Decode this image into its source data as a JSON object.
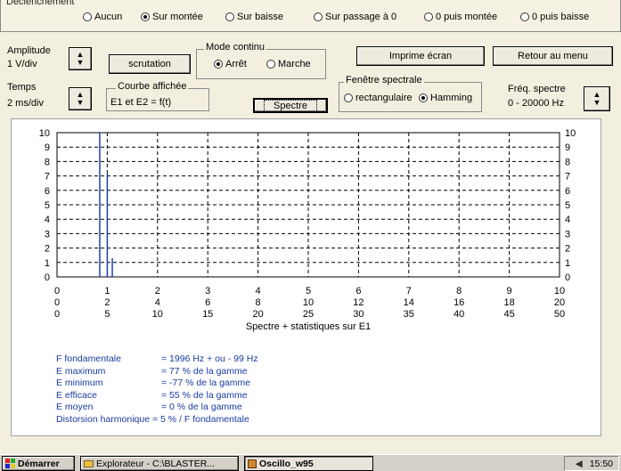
{
  "trigger": {
    "title": "Déclenchement",
    "options": [
      {
        "label": "Aucun",
        "selected": false
      },
      {
        "label": "Sur montée",
        "selected": true
      },
      {
        "label": "Sur baisse",
        "selected": false
      },
      {
        "label": "Sur passage à 0",
        "selected": false
      },
      {
        "label": "0 puis montée",
        "selected": false
      },
      {
        "label": "0 puis baisse",
        "selected": false
      }
    ]
  },
  "amplitude": {
    "label": "Amplitude",
    "value": "1 V/div"
  },
  "temps": {
    "label": "Temps",
    "value": "2 ms/div"
  },
  "scrutation_label": "scrutation",
  "mode": {
    "title": "Mode continu",
    "options": [
      {
        "label": "Arrêt",
        "selected": true
      },
      {
        "label": "Marche",
        "selected": false
      }
    ]
  },
  "courbe": {
    "title": "Courbe affichée",
    "value": "E1 et E2 = f(t)"
  },
  "spectre_label": "Spectre",
  "imprime_label": "Imprime écran",
  "retour_label": "Retour au menu",
  "fenetre": {
    "title": "Fenêtre spectrale",
    "options": [
      {
        "label": "rectangulaire",
        "selected": false
      },
      {
        "label": "Hamming",
        "selected": true
      }
    ]
  },
  "freq": {
    "label": "Fréq. spectre",
    "value": "0 - 20000 Hz"
  },
  "chart_data": {
    "type": "bar",
    "title": "Spectre + statistiques sur E1",
    "ylim": [
      0,
      10
    ],
    "y_ticks": [
      "0",
      "1",
      "2",
      "3",
      "4",
      "5",
      "6",
      "7",
      "8",
      "9",
      "10"
    ],
    "x_ticks_row1": [
      "0",
      "1",
      "2",
      "3",
      "4",
      "5",
      "6",
      "7",
      "8",
      "9",
      "10"
    ],
    "x_ticks_row2": [
      "0",
      "2",
      "4",
      "6",
      "8",
      "10",
      "12",
      "14",
      "16",
      "18",
      "20"
    ],
    "x_ticks_row3": [
      "0",
      "5",
      "10",
      "15",
      "20",
      "25",
      "30",
      "35",
      "40",
      "45",
      "50"
    ],
    "grid": true,
    "peaks": [
      {
        "x": 0.85,
        "value": 10
      },
      {
        "x": 1.0,
        "value": 7.2
      },
      {
        "x": 1.1,
        "value": 1.3
      }
    ]
  },
  "stats": [
    {
      "key": "F fondamentale",
      "value": "= 1996 Hz  + ou - 99 Hz"
    },
    {
      "key": "E maximum",
      "value": "= 77 % de la gamme"
    },
    {
      "key": "E minimum",
      "value": "= -77 % de la gamme"
    },
    {
      "key": "E efficace",
      "value": "= 55 % de la gamme"
    },
    {
      "key": "E moyen",
      "value": "= 0 % de la gamme"
    }
  ],
  "distortion": "Distorsion harmonique = 5 %  /  F fondamentale",
  "taskbar": {
    "start_label": "Démarrer",
    "explorer_label": "Explorateur - C:\\BLASTER...",
    "app_label": "Oscillo_w95",
    "clock": "15:50"
  }
}
